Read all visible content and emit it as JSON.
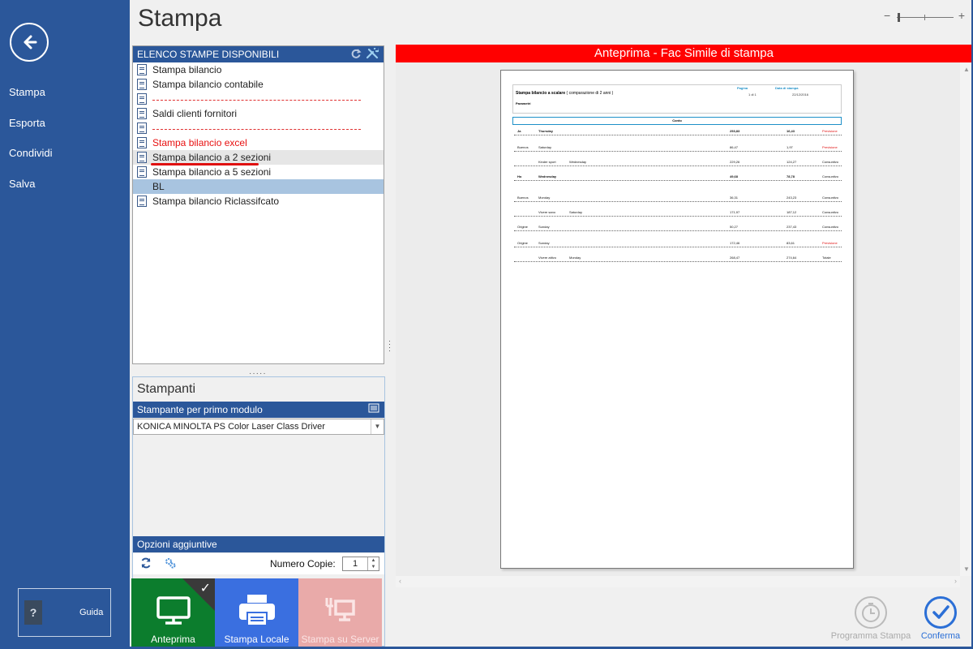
{
  "sidebar": {
    "nav": [
      {
        "label": "Stampa"
      },
      {
        "label": "Esporta"
      },
      {
        "label": "Condividi"
      },
      {
        "label": "Salva"
      }
    ],
    "guide_label": "Guida",
    "guide_icon": "help-book-icon"
  },
  "title": "Stampa",
  "zoom": {
    "minus": "−",
    "plus": "+"
  },
  "print_list": {
    "header": "ELENCO STAMPE DISPONIBILI",
    "items": [
      {
        "label": "Stampa bilancio",
        "type": "doc"
      },
      {
        "label": "Stampa bilancio contabile",
        "type": "doc"
      },
      {
        "label": "",
        "type": "separator"
      },
      {
        "label": "Saldi clienti fornitori",
        "type": "doc"
      },
      {
        "label": "",
        "type": "separator"
      },
      {
        "label": "Stampa bilancio excel",
        "type": "doc-red"
      },
      {
        "label": "Stampa bilancio a  2 sezioni",
        "type": "doc-selected"
      },
      {
        "label": "Stampa bilancio a  5 sezioni",
        "type": "doc"
      },
      {
        "label": "BL",
        "type": "highlight"
      },
      {
        "label": "Stampa bilancio Riclassifcato",
        "type": "doc"
      }
    ]
  },
  "printers": {
    "title": "Stampanti",
    "module_header": "Stampante per primo modulo",
    "selected_printer": "KONICA MINOLTA PS Color Laser Class Driver",
    "options_header": "Opzioni aggiuntive",
    "copies_label": "Numero Copie:",
    "copies_value": "1"
  },
  "tiles": {
    "anteprima": "Anteprima",
    "locale": "Stampa Locale",
    "server": "Stampa su Server"
  },
  "preview": {
    "header": "Anteprima - Fac Simile di stampa",
    "paper": {
      "title": "Stampa bilancio a scalare",
      "subtitle": "( comparazione di 2 anni )",
      "page_label": "Pagina",
      "page_value": "1 di 1",
      "date_label": "Data di stampa",
      "date_value": "22/12/2016",
      "section": "Parametri",
      "conto": "Conto",
      "rows": [
        {
          "c1": "Ja",
          "c2": "Thursday",
          "c3": "",
          "v1": "253,83",
          "v2": "16,43",
          "v3": "Previsione",
          "bold": true,
          "red": true
        },
        {
          "c1": "Buenos",
          "c2": "Saturday",
          "c3": "",
          "v1": "86,47",
          "v2": "1,97",
          "v3": "Previsione",
          "bold": false,
          "red": true
        },
        {
          "c1": "",
          "c2": "Kinder sport",
          "c3": "Wednesday",
          "v1": "229,26",
          "v2": "124,27",
          "v3": "Consuntivo",
          "bold": false,
          "red": false
        },
        {
          "c1": "Ho",
          "c2": "Wednesday",
          "c3": "",
          "v1": "49,68",
          "v2": "78,78",
          "v3": "Consuntivo",
          "bold": true,
          "red": false
        },
        {
          "c1": "Buenos",
          "c2": "Monday",
          "c3": "",
          "v1": "36,31",
          "v2": "243,23",
          "v3": "Consuntivo",
          "bold": false,
          "red": false
        },
        {
          "c1": "",
          "c2": "Vivere sano",
          "c3": "Saturday",
          "v1": "171,97",
          "v2": "187,12",
          "v3": "Consuntivo",
          "bold": false,
          "red": false
        },
        {
          "c1": "Origine",
          "c2": "Sunday",
          "c3": "",
          "v1": "50,27",
          "v2": "237,43",
          "v3": "Consuntivo",
          "bold": false,
          "red": false
        },
        {
          "c1": "Origine",
          "c2": "Sunday",
          "c3": "",
          "v1": "172,46",
          "v2": "83,61",
          "v3": "Previsione",
          "bold": false,
          "red": true
        },
        {
          "c1": "",
          "c2": "Vivere attivo",
          "c3": "Monday",
          "v1": "268,47",
          "v2": "274,64",
          "v3": "Totale",
          "bold": false,
          "red": false
        }
      ]
    }
  },
  "actions": {
    "programma": "Programma Stampa",
    "conferma": "Conferma"
  },
  "colors": {
    "accent": "#2b579a",
    "preview_header": "#ff0000",
    "tile_preview": "#0c7d2d",
    "tile_local": "#3a6fe0",
    "tile_server": "#e9aaa9",
    "confirm": "#2b6fd6"
  }
}
